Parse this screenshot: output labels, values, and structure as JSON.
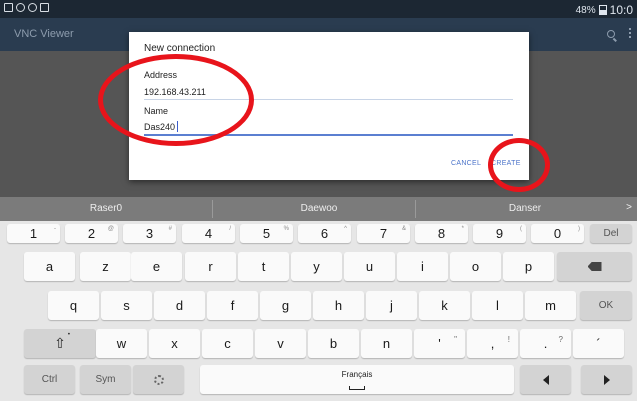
{
  "status_bar": {
    "battery": "48%",
    "time": "10:0"
  },
  "toolbar": {
    "title": "VNC Viewer",
    "search_icon": "search-icon",
    "more_icon": "more-vert-icon"
  },
  "dialog": {
    "title": "New connection",
    "address_label": "Address",
    "address_value": "192.168.43.211",
    "name_label": "Name",
    "name_value": "Das240",
    "cancel_label": "CANCEL",
    "create_label": "CREATE"
  },
  "annotation": {
    "color": "#e8141b"
  },
  "keyboard": {
    "suggestions": [
      "Raser0",
      "Daewoo",
      "Danser"
    ],
    "suggest_more_icon": "chevron-right-icon",
    "row1": [
      {
        "key": "1",
        "hint": "-"
      },
      {
        "key": "2",
        "hint": "@"
      },
      {
        "key": "3",
        "hint": "#"
      },
      {
        "key": "4",
        "hint": "/"
      },
      {
        "key": "5",
        "hint": "%"
      },
      {
        "key": "6",
        "hint": "^"
      },
      {
        "key": "7",
        "hint": "&"
      },
      {
        "key": "8",
        "hint": "*"
      },
      {
        "key": "9",
        "hint": "("
      },
      {
        "key": "0",
        "hint": ")"
      }
    ],
    "del_label": "Del",
    "row2": [
      "a",
      "z",
      "e",
      "r",
      "t",
      "y",
      "u",
      "i",
      "o",
      "p"
    ],
    "backspace_icon": "backspace-icon",
    "row3": [
      "q",
      "s",
      "d",
      "f",
      "g",
      "h",
      "j",
      "k",
      "l",
      "m"
    ],
    "ok_label": "OK",
    "shift_glyph": "⇧",
    "row4": [
      "w",
      "x",
      "c",
      "v",
      "b",
      "n"
    ],
    "row4_punct": [
      {
        "key": "'",
        "hint": "\""
      },
      {
        "key": ",",
        "hint": "!"
      },
      {
        "key": ".",
        "hint": "?"
      }
    ],
    "apostrophe": "´",
    "ctrl_label": "Ctrl",
    "sym_label": "Sym",
    "settings_icon": "gear-icon",
    "space_label": "Français",
    "left_icon": "arrow-left-icon",
    "right_icon": "arrow-right-icon"
  }
}
